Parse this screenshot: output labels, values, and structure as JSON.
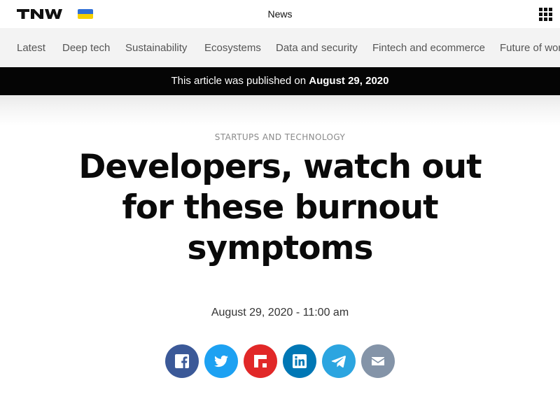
{
  "topbar": {
    "logo_text": "TNW",
    "title": "News",
    "flag_icon": "ukraine-flag",
    "menu_icon": "grid-menu-icon"
  },
  "nav": {
    "items": [
      {
        "label": "Latest"
      },
      {
        "label": "Deep tech"
      },
      {
        "label": "Sustainability"
      },
      {
        "label": "Ecosystems"
      },
      {
        "label": "Data and security"
      },
      {
        "label": "Fintech and ecommerce"
      },
      {
        "label": "Future of wor"
      }
    ]
  },
  "published": {
    "prefix": "This article was published on ",
    "date": "August 29, 2020"
  },
  "article": {
    "category": "STARTUPS AND TECHNOLOGY",
    "title_lines": [
      "Developers, watch out",
      "for these burnout",
      "symptoms"
    ],
    "dateline": "August 29, 2020 - 11:00 am"
  },
  "share": [
    {
      "name": "facebook",
      "icon": "facebook-icon",
      "color": "#3b5998"
    },
    {
      "name": "twitter",
      "icon": "twitter-icon",
      "color": "#1da1f2"
    },
    {
      "name": "flipboard",
      "icon": "flipboard-icon",
      "color": "#e12828"
    },
    {
      "name": "linkedin",
      "icon": "linkedin-icon",
      "color": "#0077b5"
    },
    {
      "name": "telegram",
      "icon": "telegram-icon",
      "color": "#2ca5e0"
    },
    {
      "name": "email",
      "icon": "email-icon",
      "color": "#8494a8"
    }
  ]
}
